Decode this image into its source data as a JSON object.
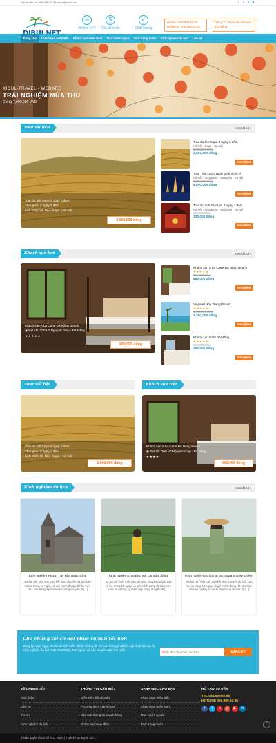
{
  "topbar": {
    "contact": "Giờ ở đâu: xe  096.996.92.95  fours@ww2c.vn"
  },
  "header": {
    "logo_text": "DIBUI.NET",
    "features": [
      {
        "label": "Hỗ trợ 24/7"
      },
      {
        "label": "Giá tốt nhất"
      },
      {
        "label": "Chất lượng"
      }
    ],
    "hotline1": "Hotline: 094.999.92.95",
    "hotline2": "Hotline 2: 096.999.92.95",
    "address": "Tầng T1 Plaza Mia Breeze Đà Nẵng"
  },
  "nav": {
    "items": [
      "Trang chủ",
      "Khách sạn miền Bắc",
      "Khách sạn miền Nam",
      "Tour nước ngoài",
      "Tour trong nước",
      "Kinh nghiệm du lịch",
      "Liên hệ"
    ]
  },
  "hero": {
    "subtitle": "XIOUL-TRAVEL - WEDARE",
    "title": "TRẢI NGHIỆM MÙA THU",
    "price": "Chỉ từ 7,990,000 VNĐ"
  },
  "sec_tour": {
    "title": "Tour du lịch",
    "more": "Xem tất cả ›"
  },
  "big_tour": {
    "name": "Tour du lịch Sapa 3 ngày 2 đêm",
    "time": "Thời gian: 3 ngày 2 đêm",
    "route": "Lịch trình: Hà Nội - Sapa - Hà Nội",
    "price": "2,000,000 đồng"
  },
  "tours": [
    {
      "name": "Tour du lịch Sapa 3 ngày 2 đêm",
      "route": "Hà Nội - Sapa - Hà Nội",
      "old": "3,000,000 đồng",
      "price": "2,000,000 đồng",
      "btn": "Xem thêm"
    },
    {
      "name": "Tour Thái Lan 4 ngày 3 đêm giá rẻ",
      "route": "Hà Nội - Singapore - Malaysia - Hà Nội",
      "old": "9,200,000 đồng",
      "price": "8,500,000 đồng",
      "btn": "Xem thêm"
    },
    {
      "name": "Tour Du lịch Giải Lạc 3 ngày 4 đêm",
      "route": "Hà Nội - Singapore - Malaysia - Hà Nội",
      "old": "150,000 đồng",
      "price": "120,000 đồng",
      "btn": "Xem thêm"
    }
  ],
  "sec_hotel": {
    "title": "Khách sạn hot",
    "more": "Xem tất cả ›"
  },
  "big_hotel": {
    "name": "Khách sạn A La Carte Đà Nẵng Beach",
    "addr": "◉ Địa chỉ: 200 Võ Nguyên Giáp - Đà Nẵng",
    "stars": "★★★★★",
    "price": "680,000 đồng"
  },
  "hotels": [
    {
      "name": "Khách sạn A La Carte Đà Nẵng Beach",
      "stars": "★★★★★",
      "old": "850,000 đồng",
      "price": "680,000 đồng",
      "btn": "Xem thêm"
    },
    {
      "name": "Vinpearl Nha Trang Resort",
      "stars": "★★★★★",
      "old": "1,500,000 đồng",
      "price": "1,350,000 đồng",
      "btn": "Xem thêm"
    },
    {
      "name": "Khách sạn Gold Đà Nẵng",
      "stars": "★★★★★",
      "old": "500,000 đồng",
      "price": "450,000 đồng",
      "btn": "Xem thêm"
    }
  ],
  "sec_tournb": {
    "title": "Tour nổi bật"
  },
  "sec_kshot": {
    "title": "Khách sạn Hot"
  },
  "feat_tour": {
    "name": "Tour du lịch Sapa 3 ngày 2 đêm",
    "time": "Thời gian: 3 ngày 2 đêm",
    "route": "Lịch trình: Hà Nội - Sapa - Hà Nội",
    "price": "2,000,000 đồng"
  },
  "feat_hotel": {
    "name": "Khách sạn A La Carte Đà Nẵng Beach",
    "addr": "◉ Địa chỉ: 200 Võ Nguyên Giáp - Đà Nẵng",
    "stars": "★★★★",
    "price": "680,000 đồng"
  },
  "sec_blog": {
    "title": "Kinh nghiệm du lịch",
    "more": "Xem tất cả ›"
  },
  "blogs": [
    {
      "title": "Kinh nghiệm Phượt Tây Bắc mùa Đông",
      "excerpt": "Sa bài dữ! Việt Anh vừa kết thúc chuyến du lịch Lào từ lúc trong 10 ngày, và giờ mình đang rất háo hức chia sẻ những kỷ niệm đẹp trong chuyến đi [...]"
    },
    {
      "title": "Kinh nghiệm checking Đà Lạt mùa đông",
      "excerpt": "Sa bài dữ! Việt Anh vừa kết thúc chuyến du lịch Lào từ lúc trong 10 ngày, và giờ mình đang rất háo hức chia sẻ những kỷ niệm đẹp trong chuyến đi [...]"
    },
    {
      "title": "Kinh nghiệm du lịch tự túc Sapa 3 ngày 2 đêm",
      "excerpt": "Sa bài dữ! Việt Anh vừa kết thúc chuyến du lịch Lào từ lúc trong 10 ngày, và giờ mình đang rất háo hức chia sẻ những kỷ niệm đẹp trong chuyến đi [...]"
    }
  ],
  "subscribe": {
    "title": "Cho chúng tôi cơ hội phục vụ bạn tốt hơn",
    "text": "Đăng ký nhận ngay liên tin du lịch miễn phí từ chúng tôi với các thông tin được cập nhật liên tục từ Kinh nghiệm du lịch, Các Tour/Điểm tham quan và các khuyến mại mới nhất.",
    "placeholder": "Nhập địa chỉ email của bạn",
    "button": "ĐĂNG KÝ"
  },
  "footer": {
    "c1": {
      "title": "VỀ CHÚNG TÔI",
      "items": [
        "Giới thiệu",
        "Liên hệ",
        "Tin tức",
        "Kinh nghiệm du lịch"
      ]
    },
    "c2": {
      "title": "THÔNG TIN CẦN BIẾT",
      "items": [
        "Điều kiện điều khoản",
        "Phương thức thanh toán",
        "Bảo mật thông tin khách hàng",
        "Chính sách quy định"
      ]
    },
    "c3": {
      "title": "DANH MỤC CHO BẠN",
      "items": [
        "Khách sạn miền Bắc",
        "Khách sạn miền Nam",
        "Tour nước ngoài",
        "Tour trong nước"
      ]
    },
    "c4": {
      "title": "HỖ TRỢ TƯ VẤN",
      "tel": "TEL 094.999.92.95",
      "hotline": "HOTLINE 096.999.92.95"
    }
  },
  "copyright": "© Bản quyền thuộc về Vi2x Team | Thiết kế và duy trì bởi ..."
}
